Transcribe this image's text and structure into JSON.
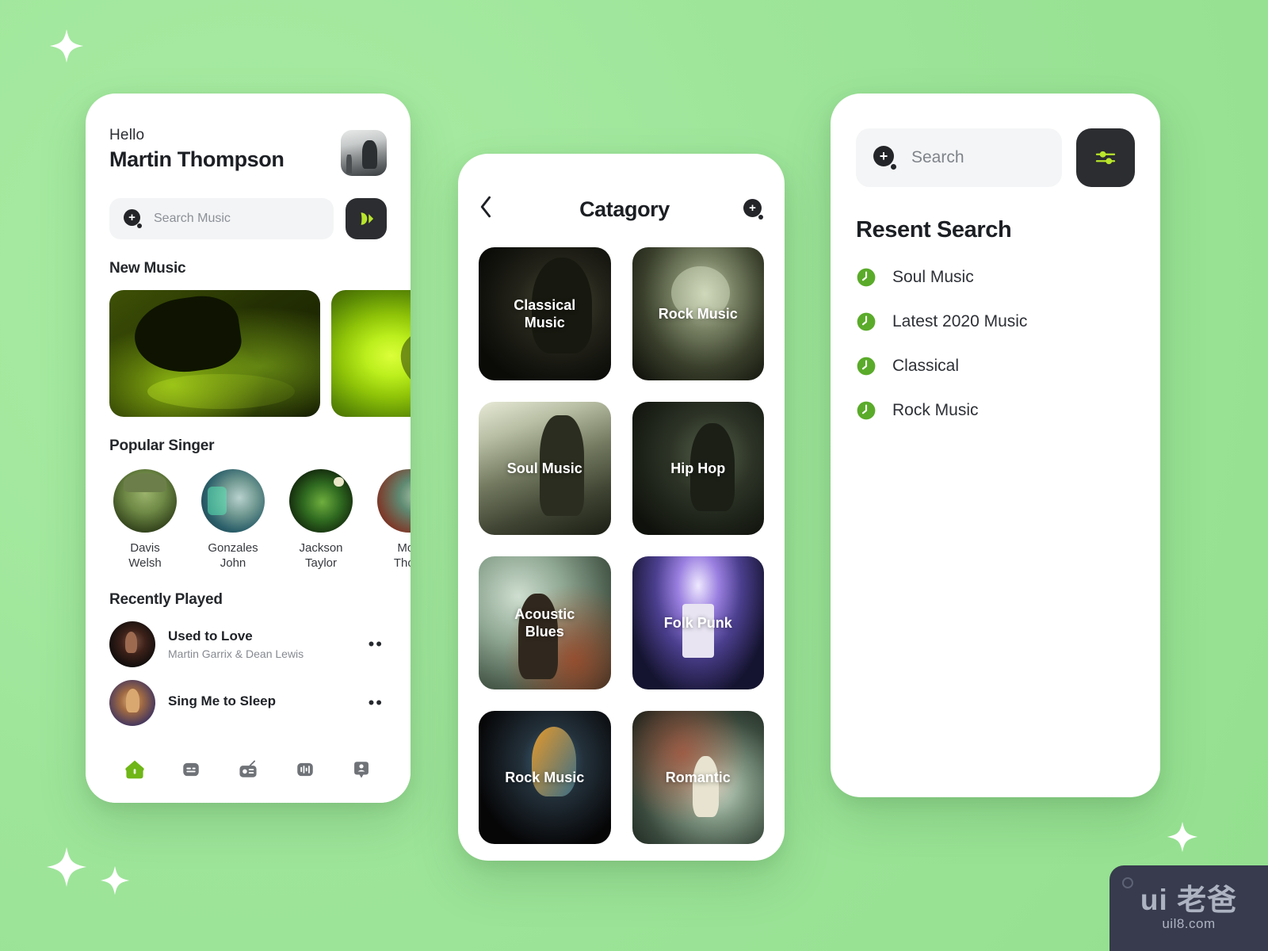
{
  "background": {
    "color": "#9ee59a",
    "accent": "#b5e82a",
    "dark": "#2b2d30",
    "green_badge": "#5aab2a"
  },
  "home": {
    "greeting": "Hello",
    "user_name": "Martin Thompson",
    "avatar_name": "user-avatar",
    "search": {
      "placeholder": "Search Music",
      "icon": "search-icon"
    },
    "play_button_icon": "play-icon",
    "new_music": {
      "title": "New Music",
      "cards": [
        {
          "name": "dj-mixer-card"
        },
        {
          "name": "green-portrait-card"
        }
      ]
    },
    "popular_singer": {
      "title": "Popular Singer",
      "singers": [
        {
          "line1": "Davis",
          "line2": "Welsh"
        },
        {
          "line1": "Gonzales",
          "line2": "John"
        },
        {
          "line1": "Jackson",
          "line2": "Taylor"
        },
        {
          "line1": "Moo",
          "line2": "Thom"
        }
      ]
    },
    "recently_played": {
      "title": "Recently Played",
      "tracks": [
        {
          "title": "Used to Love",
          "artist": "Martin Garrix & Dean Lewis",
          "menu": "••"
        },
        {
          "title": "Sing Me to Sleep",
          "artist": "",
          "menu": "••"
        }
      ]
    },
    "tabbar": [
      {
        "icon": "home-icon",
        "active": true
      },
      {
        "icon": "playlist-icon",
        "active": false
      },
      {
        "icon": "radio-icon",
        "active": false
      },
      {
        "icon": "equalizer-icon",
        "active": false
      },
      {
        "icon": "profile-icon",
        "active": false
      }
    ]
  },
  "category": {
    "back_icon": "chevron-left-icon",
    "title": "Catagory",
    "add_icon": "search-icon",
    "items": [
      {
        "label": "Classical\nMusic",
        "line1": "Classical",
        "line2": "Music"
      },
      {
        "label": "Rock Music",
        "line1": "Rock Music",
        "line2": ""
      },
      {
        "label": "Soul Music",
        "line1": "Soul Music",
        "line2": ""
      },
      {
        "label": "Hip Hop",
        "line1": "Hip Hop",
        "line2": ""
      },
      {
        "label": "Acoustic Blues",
        "line1": "Acoustic",
        "line2": "Blues"
      },
      {
        "label": "Folk Punk",
        "line1": "Folk Punk",
        "line2": ""
      },
      {
        "label": "Rock Music",
        "line1": "Rock Music",
        "line2": ""
      },
      {
        "label": "Romantic",
        "line1": "Romantic",
        "line2": ""
      }
    ]
  },
  "search_screen": {
    "search": {
      "placeholder": "Search",
      "icon": "search-icon"
    },
    "filter_icon": "filter-sliders-icon",
    "recent_title": "Resent Search",
    "recent_items": [
      {
        "label": "Soul Music",
        "icon": "clock-icon"
      },
      {
        "label": "Latest 2020 Music",
        "icon": "clock-icon"
      },
      {
        "label": "Classical",
        "icon": "clock-icon"
      },
      {
        "label": "Rock Music",
        "icon": "clock-icon"
      }
    ]
  },
  "watermark": {
    "main": "ui 老爸",
    "sub": "uil8.com"
  }
}
